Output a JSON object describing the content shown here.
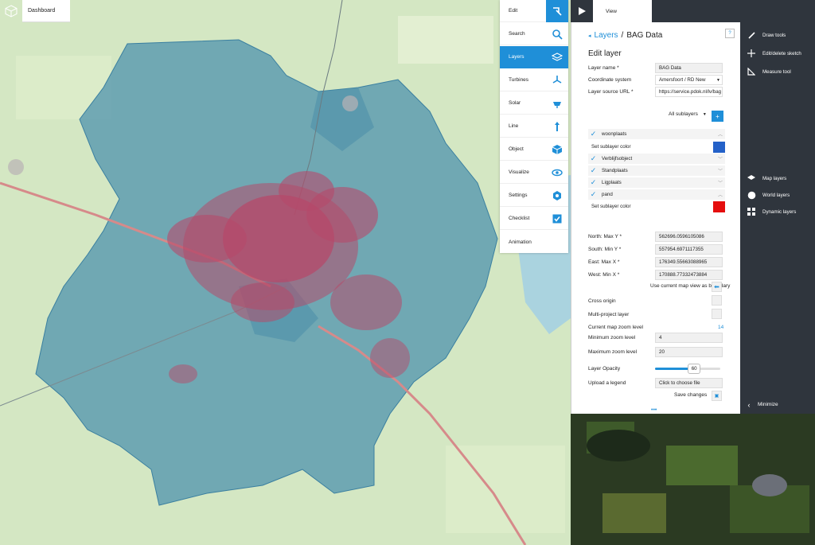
{
  "app": {
    "dashboard_label": "Dashboard"
  },
  "toolmenu": {
    "items": [
      {
        "label": "Edit",
        "icon": "edit-icon"
      },
      {
        "label": "Search",
        "icon": "search-icon"
      },
      {
        "label": "Layers",
        "icon": "layers-icon"
      },
      {
        "label": "Turbines",
        "icon": "turbine-icon"
      },
      {
        "label": "Solar",
        "icon": "solar-icon"
      },
      {
        "label": "Line",
        "icon": "line-icon"
      },
      {
        "label": "Object",
        "icon": "cube-icon"
      },
      {
        "label": "Visualize",
        "icon": "eye-icon"
      },
      {
        "label": "Settings",
        "icon": "gear-icon"
      },
      {
        "label": "Checklist",
        "icon": "checkbox-icon"
      },
      {
        "label": "Animation",
        "icon": ""
      }
    ],
    "active": "Layers"
  },
  "topbar": {
    "tab_label": "View"
  },
  "panel": {
    "breadcrumb_parent": "Layers",
    "breadcrumb_sep": "/",
    "breadcrumb_current": "BAG Data",
    "help": "?",
    "title": "Edit layer",
    "layer_name_label": "Layer name *",
    "layer_name_value": "BAG Data",
    "coord_label": "Coordinate system",
    "coord_value": "Amersfoort / RD New",
    "source_label": "Layer source URL *",
    "source_value": "https://service.pdok.nl/lv/bag",
    "all_sublayers": "All sublayers",
    "sublayers": [
      {
        "name": "woonplaats",
        "checked": true,
        "expanded": true
      },
      {
        "name": "Verblijfsobject",
        "checked": true,
        "expanded": false
      },
      {
        "name": "Standplaats",
        "checked": true,
        "expanded": false
      },
      {
        "name": "Ligplaats",
        "checked": true,
        "expanded": false
      },
      {
        "name": "pand",
        "checked": true,
        "expanded": true
      }
    ],
    "sublayer_color_label": "Set sublayer color",
    "sublayer_colors": [
      "#2461c8",
      "#e50e0e"
    ],
    "north_label": "North: Max Y *",
    "north_value": "562696.0596105086",
    "south_label": "South: Min Y *",
    "south_value": "557954.6971117355",
    "east_label": "East: Max X *",
    "east_value": "176349.55663088965",
    "west_label": "West: Min X *",
    "west_value": "170888.77332473884",
    "use_map_view": "Use current map view as boundary",
    "cross_origin_label": "Cross origin",
    "multi_project_label": "Multi-project layer",
    "current_zoom_label": "Current map zoom level",
    "current_zoom_value": "14",
    "min_zoom_label": "Minimum zoom level",
    "min_zoom_value": "4",
    "max_zoom_label": "Maximum zoom level",
    "max_zoom_value": "20",
    "opacity_label": "Layer Opacity",
    "opacity_value": "60",
    "opacity_fraction": 0.6,
    "legend_label": "Upload a legend",
    "legend_button": "Click to choose file",
    "save_label": "Save changes",
    "drag_handle": "•••"
  },
  "rightbar": {
    "tools": [
      {
        "label": "Draw tools",
        "icon": "pencil-icon"
      },
      {
        "label": "Edit/delete sketch",
        "icon": "move-icon"
      },
      {
        "label": "Measure tool",
        "icon": "ruler-icon"
      }
    ],
    "layer_views": [
      {
        "label": "Map layers",
        "icon": "map-layers-icon"
      },
      {
        "label": "World layers",
        "icon": "globe-icon"
      },
      {
        "label": "Dynamic layers",
        "icon": "grid-icon"
      }
    ],
    "minimize_label": "Minimize"
  },
  "colors": {
    "accent": "#1f8fd8",
    "dark": "#2f353d",
    "map_land": "#d5e8c4",
    "overlay": "#5a9ab0",
    "buildings": "#b54a6a"
  }
}
